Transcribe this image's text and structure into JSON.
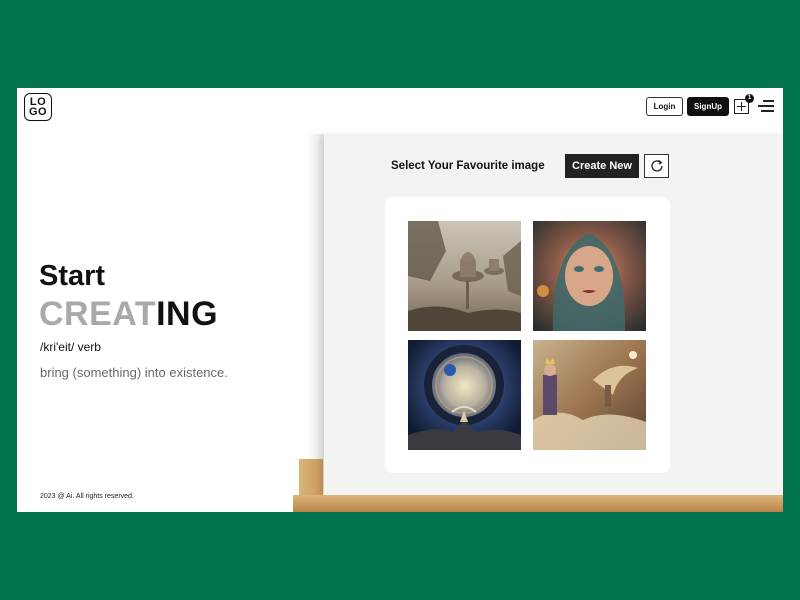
{
  "header": {
    "logo_line1": "LO",
    "logo_line2": "GO",
    "login_label": "Login",
    "signup_label": "SignUp",
    "add_badge_count": "1",
    "add_icon": "add-square-icon",
    "menu_icon": "hamburger-menu-icon"
  },
  "hero": {
    "start": "Start",
    "creating_light": "CREAT",
    "creating_dark": "ING",
    "phonetic": "/kri'eit/ verb",
    "definition": "bring (something) into existence."
  },
  "footer": {
    "copyright": "2023 @ Ai. All rights reserved."
  },
  "panel": {
    "title": "Select Your Favourite image",
    "create_new_label": "Create New",
    "refresh_icon": "refresh-icon",
    "images": [
      "fantasy-floating-temples-image",
      "portrait-woman-hood-image",
      "cosmic-portal-figure-image",
      "queen-angel-clouds-image"
    ]
  },
  "colors": {
    "background": "#037350",
    "page": "#ffffff",
    "panel": "#f3f3f2",
    "button_dark": "#111111",
    "hero_light_text": "#a9a9a9",
    "definition_text": "#6a6a6a",
    "shelf_wood": "#c9985b"
  }
}
